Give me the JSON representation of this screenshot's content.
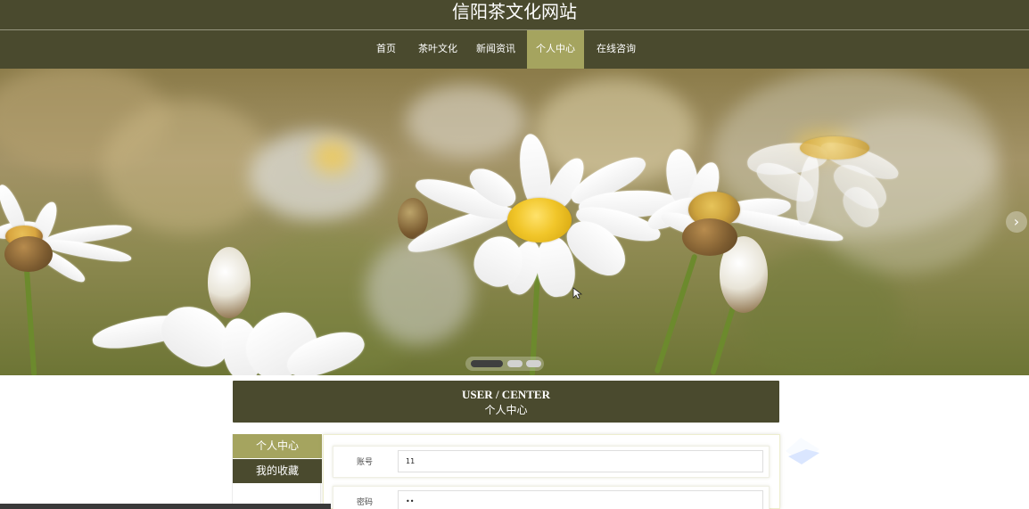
{
  "site": {
    "title": "信阳茶文化网站"
  },
  "nav": {
    "items": [
      {
        "label": "首页",
        "active": false
      },
      {
        "label": "茶叶文化",
        "active": false
      },
      {
        "label": "新闻资讯",
        "active": false
      },
      {
        "label": "个人中心",
        "active": true
      },
      {
        "label": "在线咨询",
        "active": false
      }
    ]
  },
  "banner": {
    "arrow_icon": "chevron-right-icon",
    "arrow_glyph": "›",
    "indicator_count": 3,
    "active_indicator": 0
  },
  "section": {
    "title_en": "USER / CENTER",
    "title_cn": "个人中心"
  },
  "sidebar": {
    "items": [
      {
        "label": "个人中心",
        "active": true
      },
      {
        "label": "我的收藏",
        "active": false
      }
    ]
  },
  "form": {
    "account_label": "账号",
    "account_value": "11",
    "password_label": "密码",
    "password_value": "••"
  },
  "colors": {
    "header_bg": "#4a4a2e",
    "accent": "#a5a45f",
    "text_light": "#ffffff"
  }
}
